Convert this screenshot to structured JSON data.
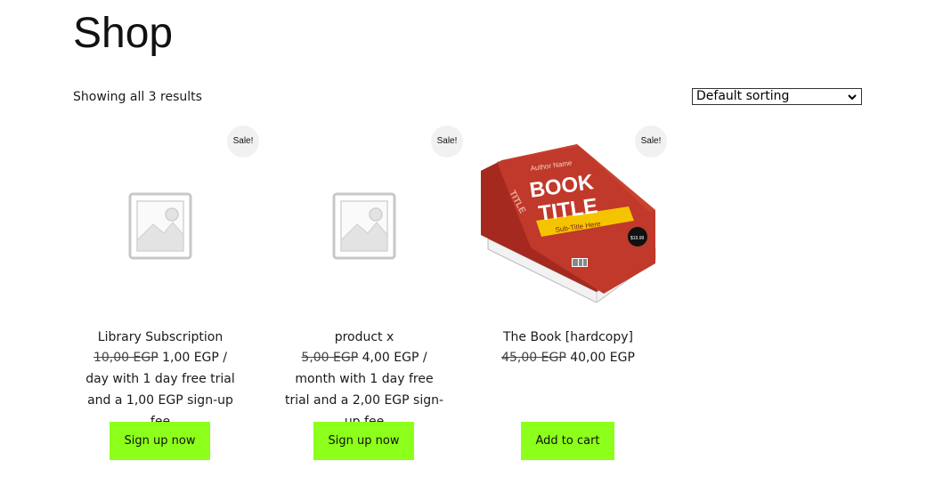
{
  "page": {
    "title": "Shop"
  },
  "toolbar": {
    "result_count": "Showing all 3 results",
    "ordering": {
      "selected": "Default sorting",
      "icon": "chevron-down-icon"
    }
  },
  "colors": {
    "button_bg": "#8cff1a",
    "badge_bg": "#f1f1f1",
    "book_cover": "#c0392b",
    "book_band": "#f4c400"
  },
  "products": [
    {
      "name": "Library Subscription",
      "sale_label": "Sale!",
      "image": "placeholder-image-icon",
      "regular_price": "10,00 EGP",
      "sale_price": "1,00 EGP",
      "price_details": " / day with 1 day free trial and a 1,00 EGP sign-up fee",
      "button_label": "Sign up now"
    },
    {
      "name": "product x",
      "sale_label": "Sale!",
      "image": "placeholder-image-icon",
      "regular_price": "5,00 EGP",
      "sale_price": "4,00 EGP",
      "price_details": " / month with 1 day free trial and a 2,00 EGP sign-up fee",
      "button_label": "Sign up now"
    },
    {
      "name": "The Book [hardcopy]",
      "sale_label": "Sale!",
      "image": "book-cover-image",
      "cover_text": {
        "author": "Author Name",
        "title_line1": "BOOK",
        "title_line2": "TITLE",
        "subtitle": "Sub-Title Here",
        "spine": "TITLE",
        "price_sticker": "$19.99"
      },
      "regular_price": "45,00 EGP",
      "sale_price": "40,00 EGP",
      "price_details": "",
      "button_label": "Add to cart"
    }
  ]
}
